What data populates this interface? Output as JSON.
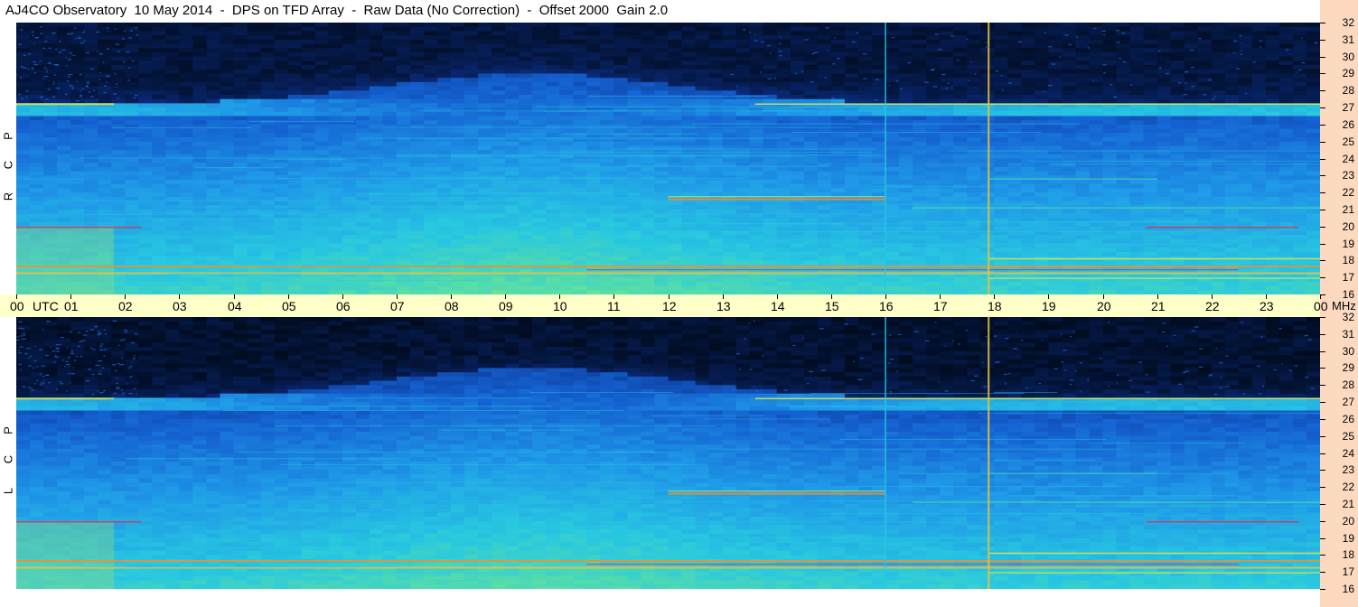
{
  "title": "AJ4CO Observatory  10 May 2014  -  DPS on TFD Array  -  Raw Data (No Correction)  -  Offset 2000  Gain 2.0",
  "chart_data": {
    "type": "heatmap",
    "title": "AJ4CO Observatory  10 May 2014  -  DPS on TFD Array  -  Raw Data (No Correction)  -  Offset 2000  Gain 2.0",
    "xlabel": "UTC",
    "ylabel": "MHz",
    "x_ticks": [
      "00",
      "01",
      "02",
      "03",
      "04",
      "05",
      "06",
      "07",
      "08",
      "09",
      "10",
      "11",
      "12",
      "13",
      "14",
      "15",
      "16",
      "17",
      "18",
      "19",
      "20",
      "21",
      "22",
      "23",
      "00"
    ],
    "x_range_hours": [
      0,
      24
    ],
    "y_range_mhz": [
      16,
      32
    ],
    "y_ticks": [
      16,
      17,
      18,
      19,
      20,
      21,
      22,
      23,
      24,
      25,
      26,
      27,
      28,
      29,
      30,
      31,
      32
    ],
    "panels": [
      {
        "name": "R C P",
        "letters": [
          "R",
          "C",
          "P"
        ]
      },
      {
        "name": "L C P",
        "letters": [
          "L",
          "C",
          "P"
        ]
      }
    ],
    "colormap": [
      "#000814",
      "#0a2a7a",
      "#1460d0",
      "#1f9ae8",
      "#28c8e0",
      "#5ee0a0",
      "#e8e840",
      "#f09030",
      "#e03050"
    ],
    "features": {
      "ionospheric_cutoff_night_mhz": 27.2,
      "interference_lines_utc": [
        16.0,
        17.9
      ],
      "strong_bands_mhz": [
        17.3,
        17.7,
        21.6,
        27.2
      ]
    }
  },
  "time_axis": {
    "unit_left": "UTC",
    "unit_right": "MHz"
  }
}
